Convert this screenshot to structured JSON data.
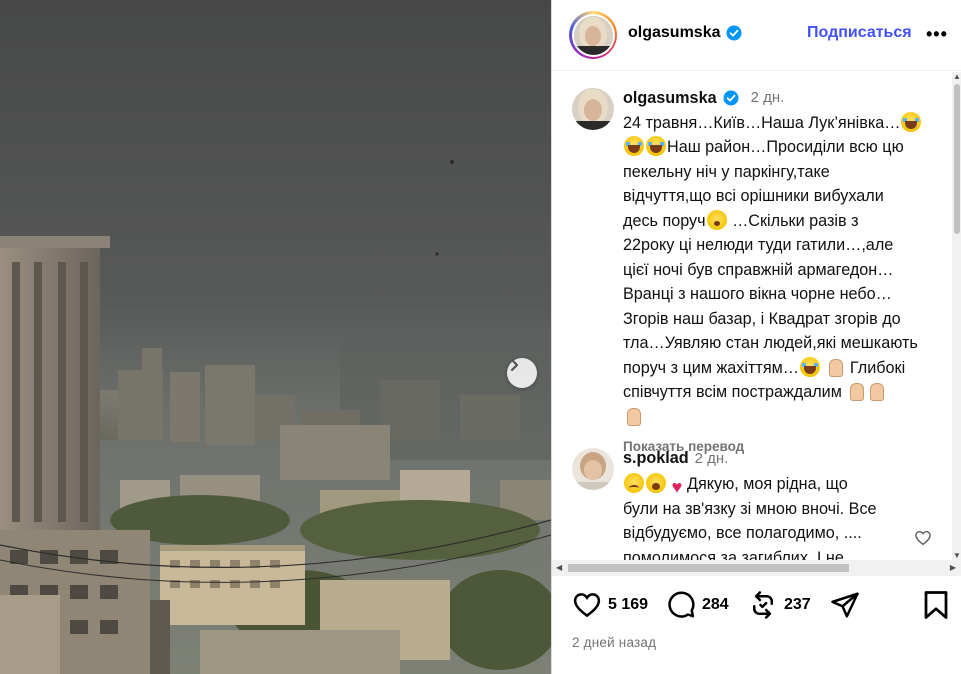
{
  "author": {
    "username": "olgasumska",
    "follow_label": "Подписаться",
    "more_label": "•••"
  },
  "caption": {
    "username": "olgasumska",
    "time": "2 дн.",
    "lines": [
      "24 травня…Київ…Наша Лук’янівка…",
      "Наш район…Просиділи всю цю",
      "пекельну ніч у паркінгу,таке",
      "відчуття,що всі орішники вибухали",
      "десь поруч",
      "…Скільки разів з",
      "22року ці нелюди туди гатили…,але",
      "цієї ночі був справжній армагедон…",
      "Вранці з нашого вікна чорне небо…",
      "Згорів наш базар, і Квадрат згорів до",
      "тла…Уявляю стан людей,які мешкають",
      "поруч з цим жахіттям…",
      "Глибокі",
      "співчуття всім постраждалим"
    ],
    "translate_label": "Показать перевод"
  },
  "comment": {
    "username": "s.poklad",
    "time": "2 дн.",
    "lines": [
      "Дякую, моя рідна, що",
      "були на зв'язку зі мною вночі. Все",
      "відбудуємо, все полагодимо, ....",
      "помолимося за загиблих. І не"
    ]
  },
  "actions": {
    "likes": "5 169",
    "comments": "284",
    "reposts": "237"
  },
  "post_date": "2 дней назад",
  "icons": {
    "next": "chevron-right-icon",
    "verified": "verified-badge-icon",
    "like": "heart-icon",
    "comment": "comment-bubble-icon",
    "repost": "repost-icon",
    "share": "paper-plane-icon",
    "save": "bookmark-icon"
  },
  "colors": {
    "follow": "#4150f7",
    "verified": "#0095f6",
    "muted": "#737373"
  }
}
